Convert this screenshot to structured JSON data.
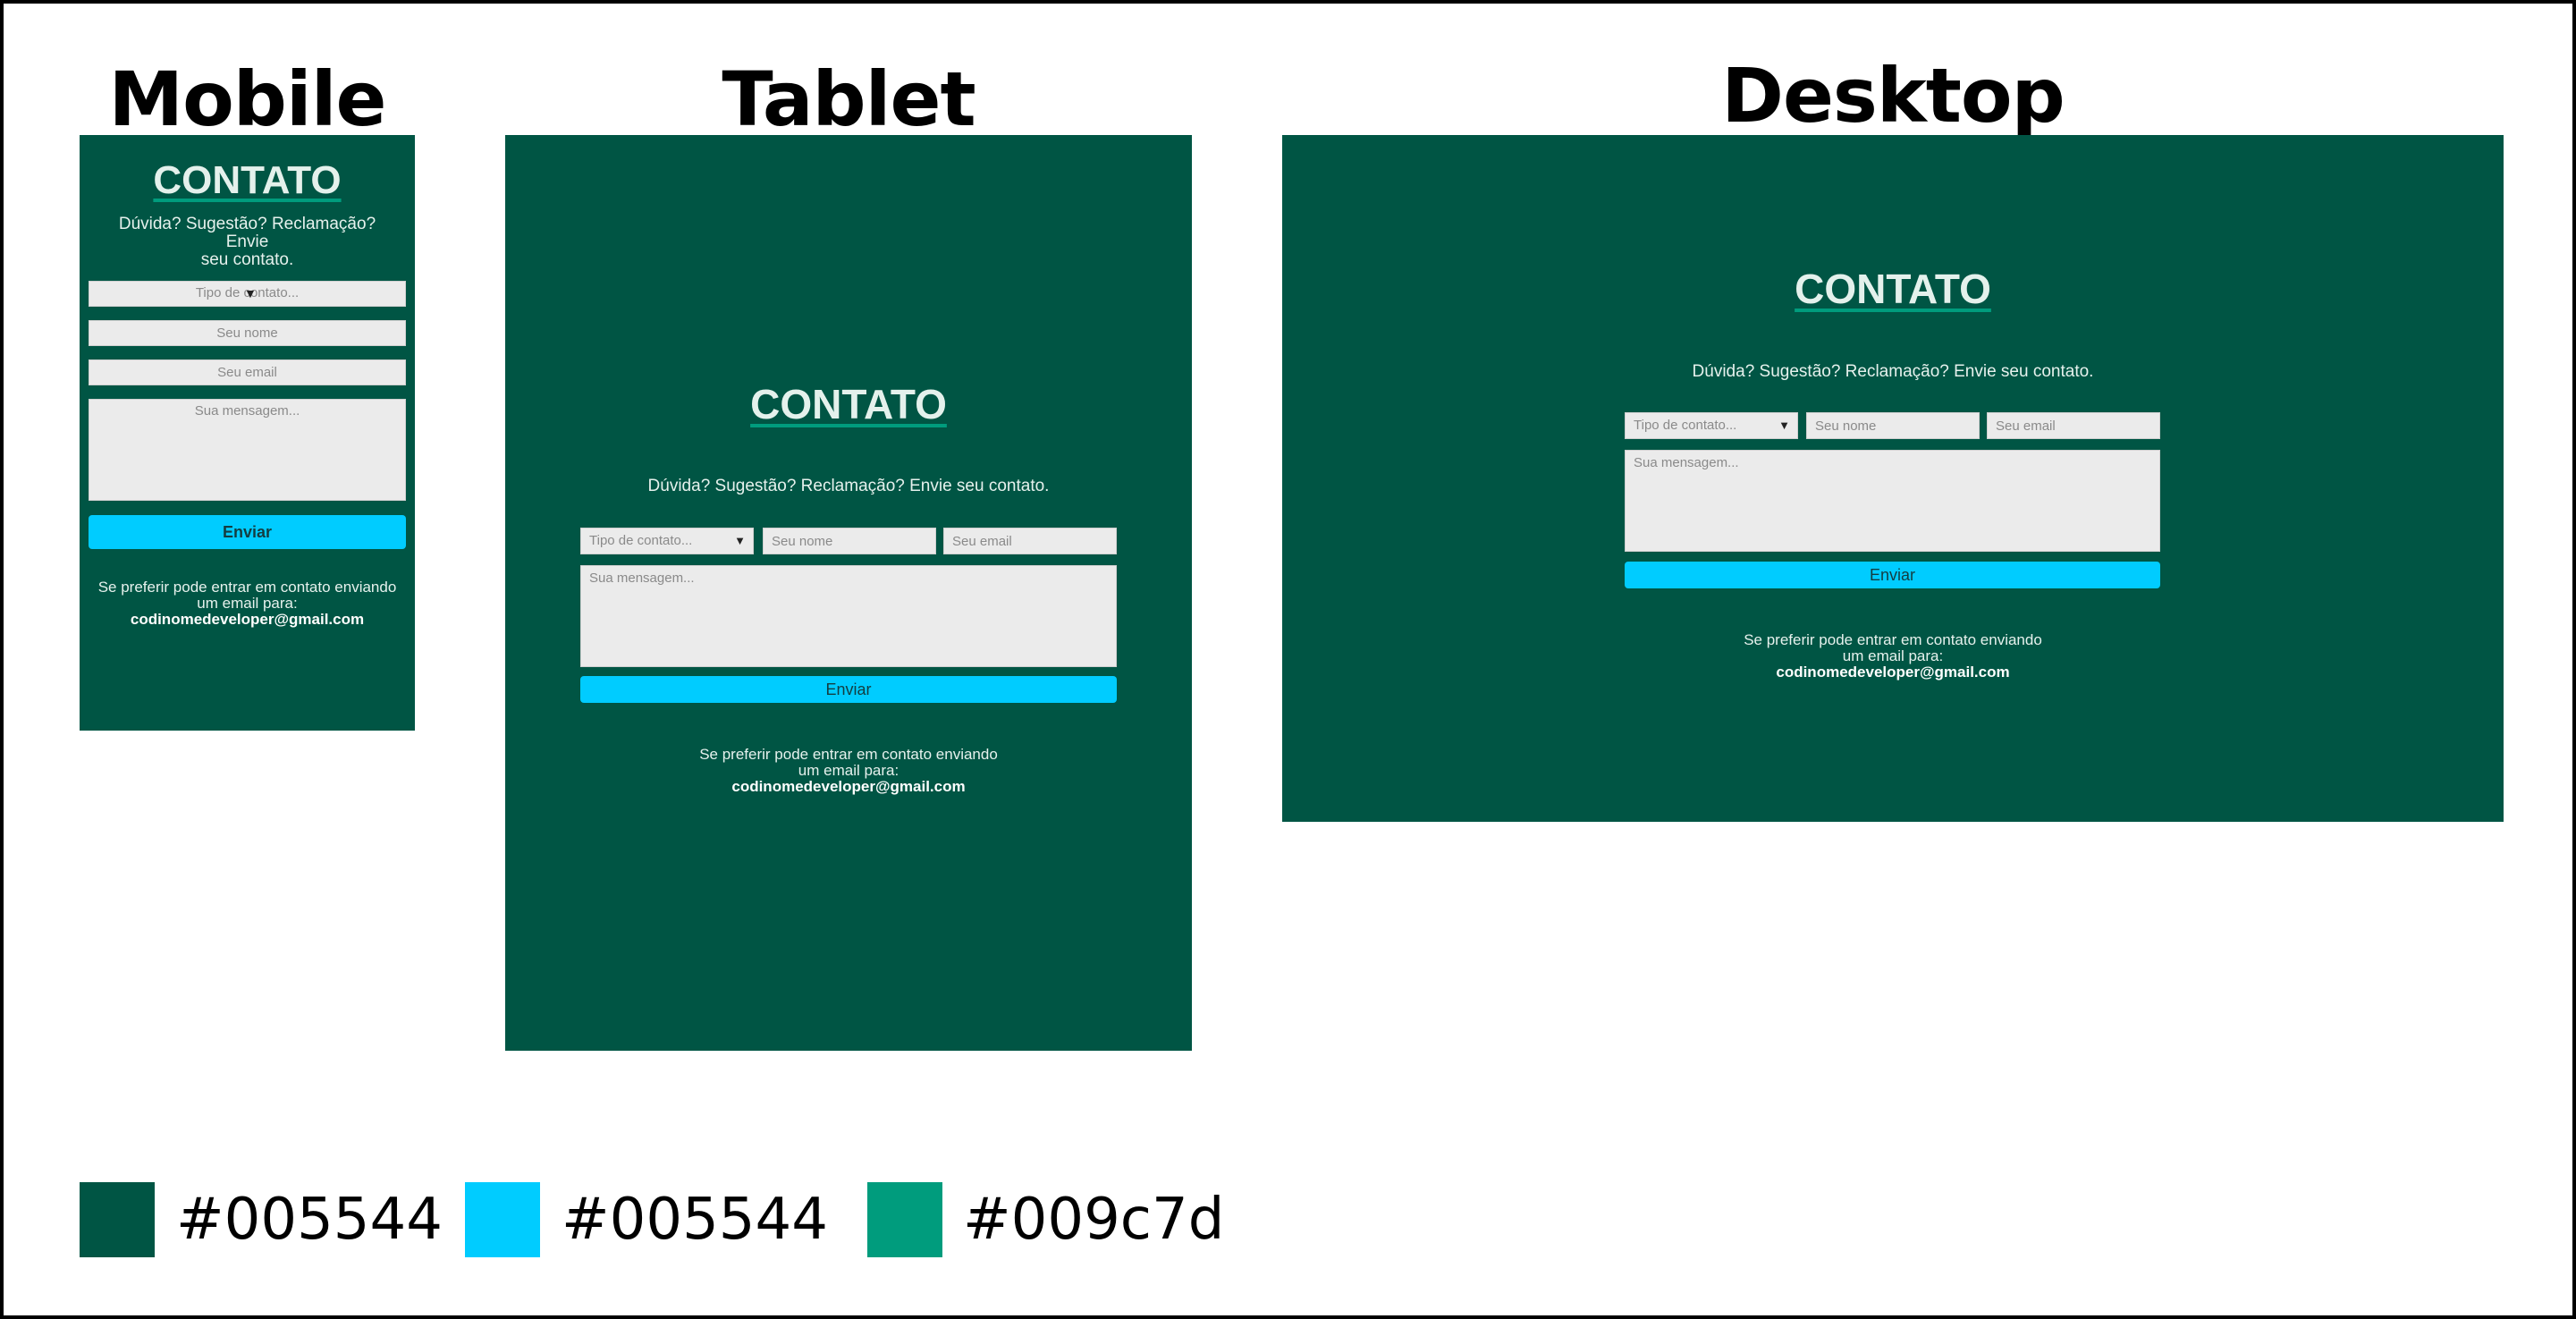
{
  "headings": {
    "mobile": "Mobile",
    "tablet": "Tablet",
    "desktop": "Desktop"
  },
  "contact": {
    "title": "CONTATO",
    "lead_full": "Dúvida? Sugestão? Reclamação? Envie seu contato.",
    "lead_line1": "Dúvida? Sugestão? Reclamação? Envie",
    "lead_line2": "seu contato.",
    "type_placeholder": "Tipo de contato...",
    "name_placeholder": "Seu nome",
    "email_placeholder": "Seu email",
    "message_placeholder": "Sua mensagem...",
    "submit_label": "Enviar",
    "footer_line1": "Se preferir pode entrar em contato enviando",
    "footer_line2": "um email para:",
    "footer_email": "codinomedeveloper@gmail.com",
    "caret_icon": "dropdown-caret-icon"
  },
  "palette": [
    {
      "color": "#005544",
      "label": "#005544"
    },
    {
      "color": "#00ccff",
      "label": "#005544"
    },
    {
      "color": "#009c7d",
      "label": "#009c7d"
    }
  ]
}
